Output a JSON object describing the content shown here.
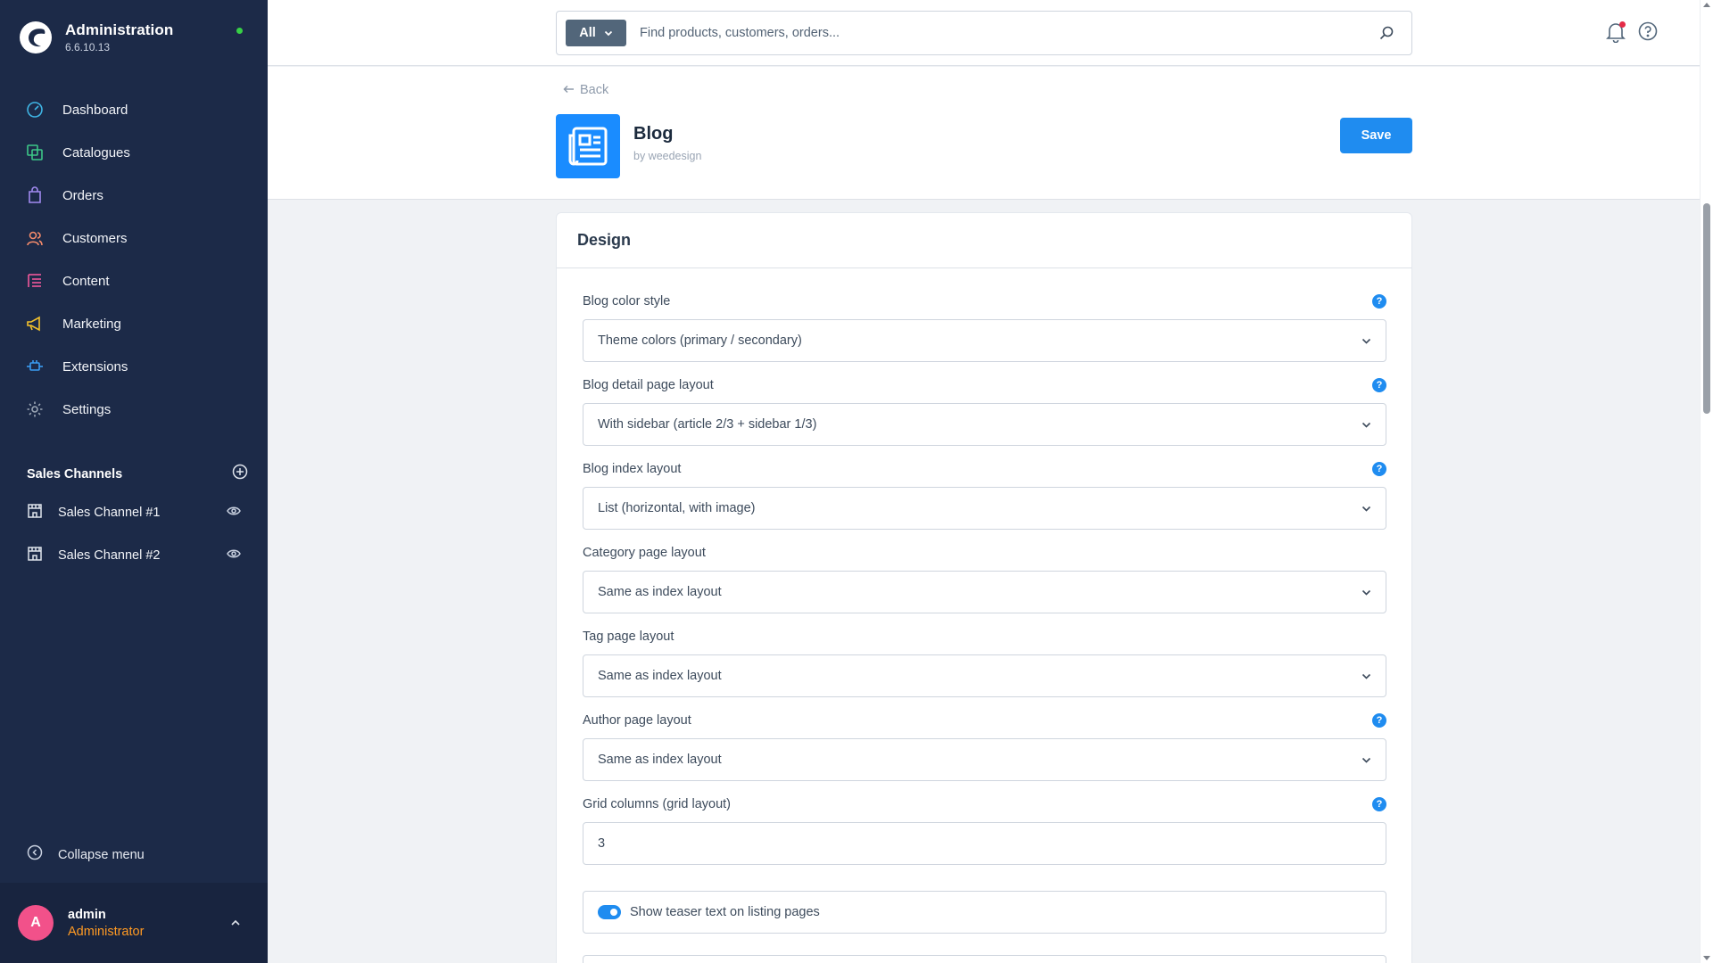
{
  "app": {
    "title": "Administration",
    "version": "6.6.10.13"
  },
  "nav": [
    {
      "label": "Dashboard",
      "icon": "dashboard-icon"
    },
    {
      "label": "Catalogues",
      "icon": "catalogues-icon"
    },
    {
      "label": "Orders",
      "icon": "orders-icon"
    },
    {
      "label": "Customers",
      "icon": "customers-icon"
    },
    {
      "label": "Content",
      "icon": "content-icon"
    },
    {
      "label": "Marketing",
      "icon": "marketing-icon"
    },
    {
      "label": "Extensions",
      "icon": "extensions-icon"
    },
    {
      "label": "Settings",
      "icon": "settings-icon"
    }
  ],
  "sales_channels": {
    "title": "Sales Channels",
    "items": [
      {
        "label": "Sales Channel #1"
      },
      {
        "label": "Sales Channel #2"
      }
    ]
  },
  "collapse_label": "Collapse menu",
  "user": {
    "initial": "A",
    "name": "admin",
    "role": "Administrator"
  },
  "search": {
    "type": "All",
    "placeholder": "Find products, customers, orders..."
  },
  "smartbar": {
    "back_label": "Back",
    "plugin_name": "Blog",
    "plugin_author": "by weedesign",
    "save_label": "Save"
  },
  "card": {
    "title": "Design",
    "fields": [
      {
        "label": "Blog color style",
        "value": "Theme colors (primary / secondary)",
        "help": true
      },
      {
        "label": "Blog detail page layout",
        "value": "With sidebar (article 2/3 + sidebar 1/3)",
        "help": true
      },
      {
        "label": "Blog index layout",
        "value": "List (horizontal, with image)",
        "help": true
      },
      {
        "label": "Category page layout",
        "value": "Same as index layout",
        "help": false
      },
      {
        "label": "Tag page layout",
        "value": "Same as index layout",
        "help": false
      },
      {
        "label": "Author page layout",
        "value": "Same as index layout",
        "help": true
      }
    ],
    "grid_columns": {
      "label": "Grid columns (grid layout)",
      "value": "3"
    },
    "teaser_toggle": {
      "label": "Show teaser text on listing pages",
      "checked": true
    }
  },
  "colors": {
    "sidebar_bg": "#1c2a48",
    "accent": "#1f8cf0",
    "role_orange": "#ff9a23",
    "avatar_pink": "#f2518a",
    "status_green": "#37d046"
  }
}
